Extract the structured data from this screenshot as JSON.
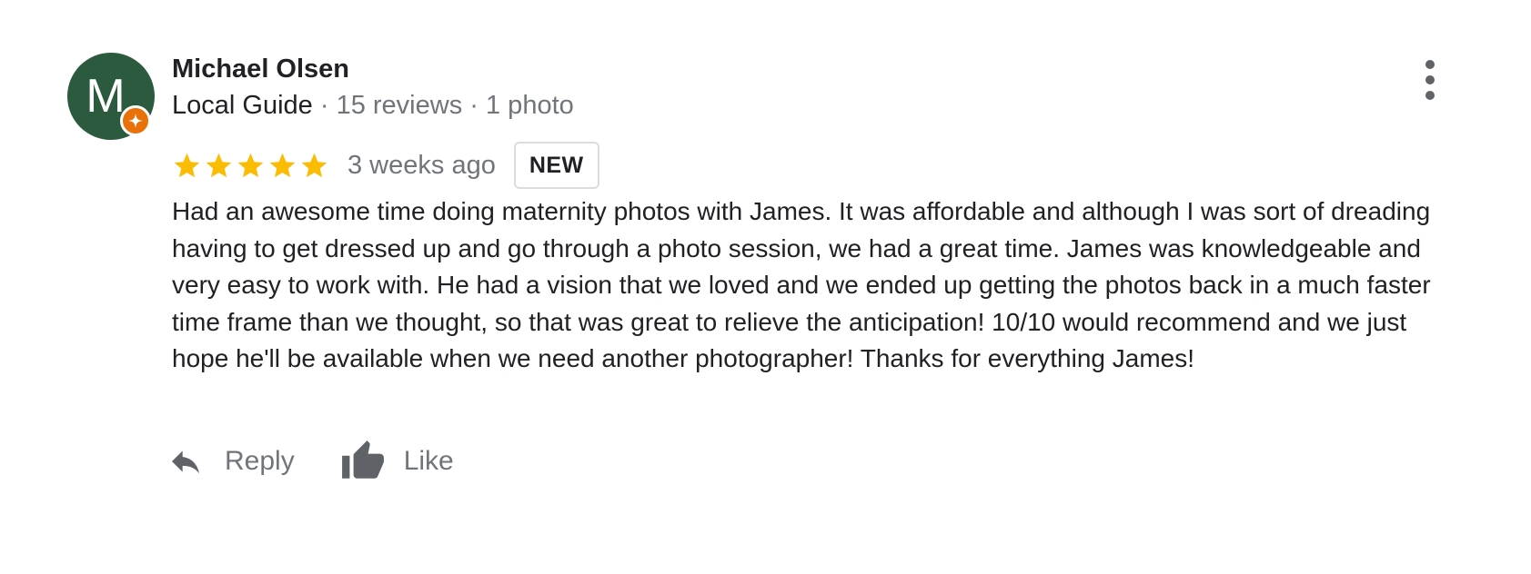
{
  "author": {
    "initial": "M",
    "name": "Michael Olsen",
    "badge_label": "Local Guide",
    "separator": "·",
    "reviews_count": "15 reviews",
    "photos_count": "1 photo",
    "avatar_color": "#2c5a3f",
    "badge_color": "#e8710a",
    "badge_icon": "local-guide-star-icon"
  },
  "rating": {
    "stars": 5,
    "max_stars": 5,
    "star_color": "#fbbc04",
    "time_ago": "3 weeks ago",
    "new_badge": "NEW"
  },
  "review": {
    "text": "Had an awesome time doing maternity photos with James. It was affordable and although I was sort of dreading having to get dressed up and go through a photo session, we had a great time. James was knowledgeable and very easy to work with. He had a vision that we loved and we ended up getting the photos back in a much faster time frame than we thought, so that was great to relieve the anticipation! 10/10 would recommend and we just hope he'll be available when we need another photographer! Thanks for everything James!"
  },
  "actions": {
    "reply_label": "Reply",
    "reply_icon": "reply-arrow-icon",
    "like_label": "Like",
    "like_icon": "thumbs-up-icon"
  },
  "menu": {
    "icon": "more-vertical-icon"
  }
}
